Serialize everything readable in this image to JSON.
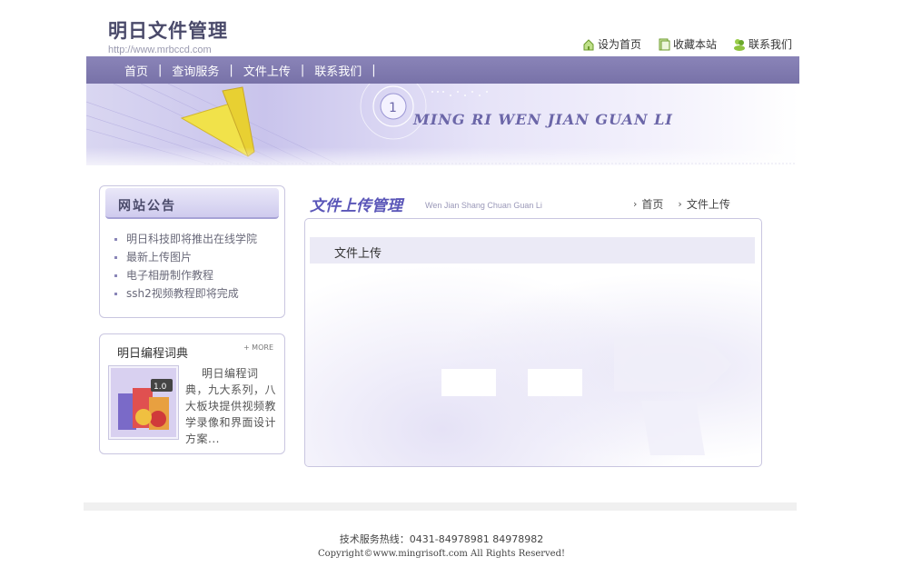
{
  "header": {
    "logo_title": "明日文件管理",
    "logo_url": "http://www.mrbccd.com",
    "links": [
      {
        "label": "设为首页",
        "icon": "home-icon"
      },
      {
        "label": "收藏本站",
        "icon": "bookmark-icon"
      },
      {
        "label": "联系我们",
        "icon": "contact-icon"
      }
    ]
  },
  "nav": {
    "items": [
      "首页",
      "查询服务",
      "文件上传",
      "联系我们"
    ]
  },
  "banner": {
    "text": "MING RI WEN JIAN GUAN LI"
  },
  "notice": {
    "title": "网站公告",
    "items": [
      "明日科技即将推出在线学院",
      "最新上传图片",
      "电子相册制作教程",
      "ssh2视频教程即将完成"
    ]
  },
  "dictionary": {
    "title": "明日编程词典",
    "more": "+ MORE",
    "description": "明日编程词典，九大系列，八大板块提供视频教学录像和界面设计方案...",
    "version_badge": "1.0"
  },
  "main": {
    "title": "文件上传管理",
    "subtitle": "Wen Jian Shang Chuan Guan Li",
    "breadcrumbs": [
      "首页",
      "文件上传"
    ],
    "section_label": "文件上传"
  },
  "footer": {
    "phone": "技术服务热线：0431-84978981   84978982",
    "copyright": "Copyright©www.mingrisoft.com All Rights Reserved!"
  },
  "colors": {
    "nav_bg": "#7872a8",
    "accent": "#5a56b8",
    "border": "#c9c6e0"
  }
}
